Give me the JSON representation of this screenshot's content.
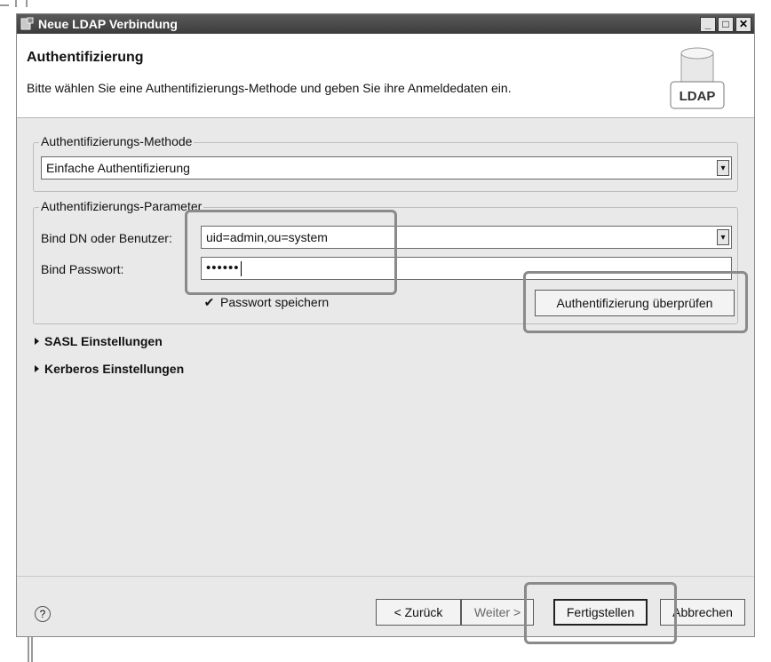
{
  "window": {
    "title": "Neue LDAP Verbindung",
    "controls": {
      "minimize": "_",
      "maximize": "□",
      "close": "✕"
    }
  },
  "header": {
    "title": "Authentifizierung",
    "description": "Bitte wählen Sie eine Authentifizierungs-Methode und geben Sie ihre Anmeldedaten ein.",
    "icon_label": "LDAP"
  },
  "method_group": {
    "legend": "Authentifizierungs-Methode",
    "selected": "Einfache Authentifizierung"
  },
  "params_group": {
    "legend": "Authentifizierungs-Parameter",
    "bind_dn_label": "Bind DN oder Benutzer:",
    "bind_dn_value": "uid=admin,ou=system",
    "password_label": "Bind Passwort:",
    "password_value": "••••••",
    "save_password_label": "Passwort speichern",
    "save_password_checked": true,
    "check_button": "Authentifizierung überprüfen"
  },
  "sections": [
    {
      "label": "SASL Einstellungen"
    },
    {
      "label": "Kerberos Einstellungen"
    }
  ],
  "footer": {
    "back": "< Zurück",
    "next": "Weiter >",
    "finish": "Fertigstellen",
    "cancel": "Abbrechen"
  },
  "icons": {
    "help": "help-icon",
    "dropdown": "chevron-down-icon",
    "expand": "triangle-right-icon"
  },
  "colors": {
    "titlebar": "#4a4a4a",
    "dialog_bg": "#e9e9e9",
    "header_bg": "#ffffff",
    "highlight": "#8a8a8a"
  }
}
